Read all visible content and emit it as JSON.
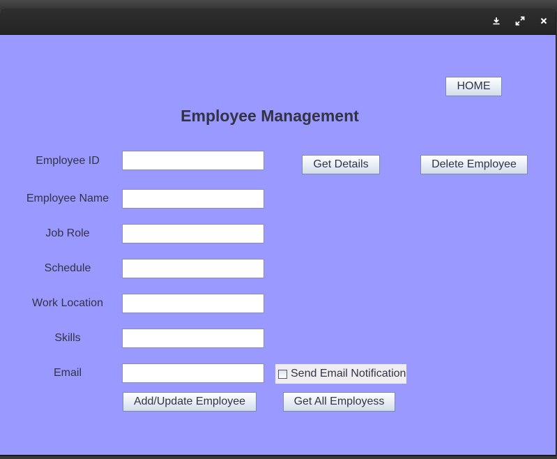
{
  "window": {
    "controls": [
      "download-icon",
      "expand-icon",
      "close-icon"
    ]
  },
  "header": {
    "title": "Employee Management",
    "home_label": "HOME"
  },
  "form": {
    "fields": [
      {
        "label": "Employee ID",
        "value": ""
      },
      {
        "label": "Employee Name",
        "value": ""
      },
      {
        "label": "Job Role",
        "value": ""
      },
      {
        "label": "Schedule",
        "value": ""
      },
      {
        "label": "Work Location",
        "value": ""
      },
      {
        "label": "Skills",
        "value": ""
      },
      {
        "label": "Email",
        "value": ""
      }
    ],
    "send_email_label": "Send Email Notification",
    "send_email_checked": false
  },
  "actions": {
    "get_details": "Get Details",
    "delete_employee": "Delete Employee",
    "add_update": "Add/Update Employee",
    "get_all": "Get All Employess"
  },
  "colors": {
    "background": "#9999ff",
    "titlebar": "#2a2a2a",
    "text": "#333344"
  }
}
